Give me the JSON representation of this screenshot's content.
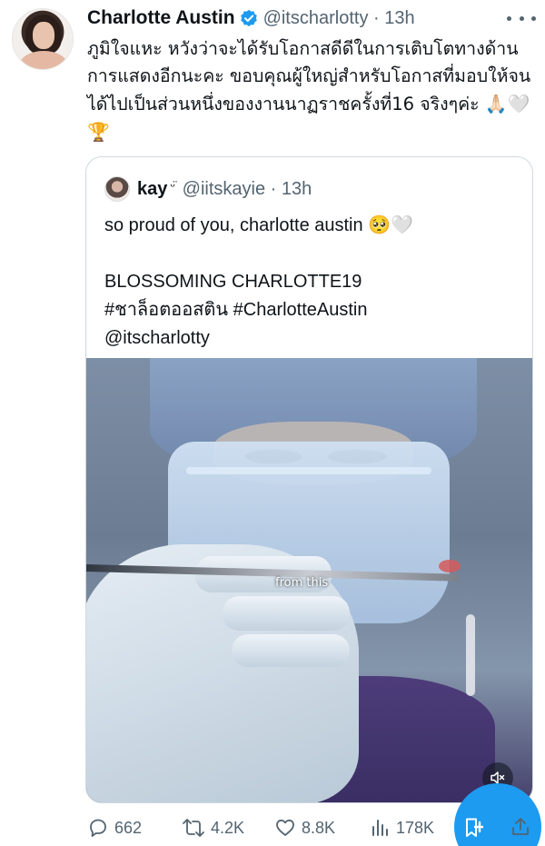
{
  "tweet": {
    "author": {
      "display_name": "Charlotte Austin",
      "handle_time": "@itscharlotty · 13h"
    },
    "text": "ภูมิใจแหะ หวังว่าจะได้รับโอกาสดีดีในการเติบโตทางด้านการแสดงอีกนะคะ ขอบคุณผู้ใหญ่สำหรับโอกาสที่มอบให้จนได้ไปเป็นส่วนหนึ่งของงานนาฏราชครั้งที่16 จริงๆค่ะ ",
    "text_emoji": "🙏🏻🤍🏆"
  },
  "quote": {
    "display_name": "kay",
    "name_badge": "ᵕ̈",
    "handle_time": "@iitskayie · 13h",
    "text": "so proud of you, charlotte austin 🥺🤍\n\nBLOSSOMING CHARLOTTE19\n#ชาล็อตออสติน #CharlotteAustin\n@itscharlotty",
    "video_caption": "from this"
  },
  "stats": {
    "replies": "662",
    "reposts": "4.2K",
    "likes": "8.8K",
    "views": "178K"
  },
  "icons": [
    "verified-badge-icon",
    "more-icon",
    "mute-icon",
    "reply-icon",
    "repost-icon",
    "like-icon",
    "views-icon",
    "bookmark-icon",
    "share-icon"
  ],
  "colors": {
    "accent": "#1d9bf0",
    "secondary_text": "#536471",
    "border": "#cfd9de"
  }
}
